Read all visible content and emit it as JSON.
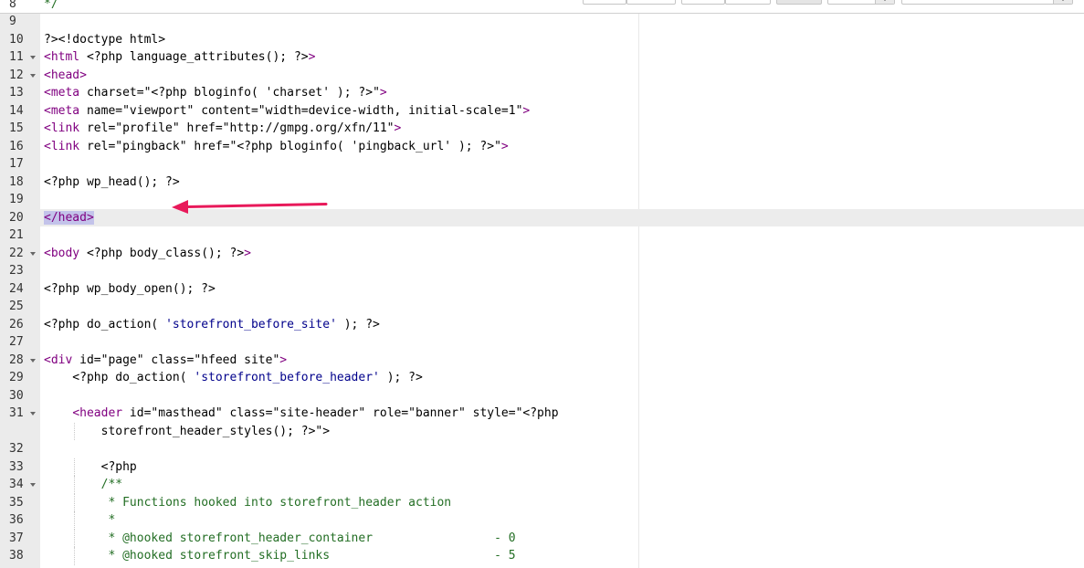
{
  "toolbar": {
    "controls": [
      "",
      "",
      "",
      "",
      "",
      "",
      ""
    ]
  },
  "colors": {
    "tag": "#800080",
    "attr": "#008000",
    "string": "#00008b",
    "comment": "#236e24",
    "arrow": "#e8195a"
  },
  "annotation": {
    "icon": "arrow-left-icon"
  },
  "editor": {
    "lines": [
      {
        "num": "8",
        "fold": false,
        "text": "*/"
      },
      {
        "num": "9",
        "fold": false,
        "text": ""
      },
      {
        "num": "10",
        "fold": false,
        "text": "?><!doctype html>"
      },
      {
        "num": "11",
        "fold": true,
        "text": "<html <?php language_attributes(); ?>>"
      },
      {
        "num": "12",
        "fold": true,
        "text": "<head>"
      },
      {
        "num": "13",
        "fold": false,
        "text": "<meta charset=\"<?php bloginfo( 'charset' ); ?>\">"
      },
      {
        "num": "14",
        "fold": false,
        "text": "<meta name=\"viewport\" content=\"width=device-width, initial-scale=1\">"
      },
      {
        "num": "15",
        "fold": false,
        "text": "<link rel=\"profile\" href=\"http://gmpg.org/xfn/11\">"
      },
      {
        "num": "16",
        "fold": false,
        "text": "<link rel=\"pingback\" href=\"<?php bloginfo( 'pingback_url' ); ?>\">"
      },
      {
        "num": "17",
        "fold": false,
        "text": ""
      },
      {
        "num": "18",
        "fold": false,
        "text": "<?php wp_head(); ?>"
      },
      {
        "num": "19",
        "fold": false,
        "text": ""
      },
      {
        "num": "20",
        "fold": false,
        "text": "</head>"
      },
      {
        "num": "21",
        "fold": false,
        "text": ""
      },
      {
        "num": "22",
        "fold": true,
        "text": "<body <?php body_class(); ?>>"
      },
      {
        "num": "23",
        "fold": false,
        "text": ""
      },
      {
        "num": "24",
        "fold": false,
        "text": "<?php wp_body_open(); ?>"
      },
      {
        "num": "25",
        "fold": false,
        "text": ""
      },
      {
        "num": "26",
        "fold": false,
        "text": "<?php do_action( 'storefront_before_site' ); ?>"
      },
      {
        "num": "27",
        "fold": false,
        "text": ""
      },
      {
        "num": "28",
        "fold": true,
        "text": "<div id=\"page\" class=\"hfeed site\">"
      },
      {
        "num": "29",
        "fold": false,
        "text": "    <?php do_action( 'storefront_before_header' ); ?>"
      },
      {
        "num": "30",
        "fold": false,
        "text": ""
      },
      {
        "num": "31",
        "fold": true,
        "text": "    <header id=\"masthead\" class=\"site-header\" role=\"banner\" style=\"<?php"
      },
      {
        "num": "",
        "fold": false,
        "text": "        storefront_header_styles(); ?>\">"
      },
      {
        "num": "32",
        "fold": false,
        "text": ""
      },
      {
        "num": "33",
        "fold": false,
        "text": "        <?php"
      },
      {
        "num": "34",
        "fold": true,
        "text": "        /**"
      },
      {
        "num": "35",
        "fold": false,
        "text": "         * Functions hooked into storefront_header action"
      },
      {
        "num": "36",
        "fold": false,
        "text": "         *"
      },
      {
        "num": "37",
        "fold": false,
        "text": "         * @hooked storefront_header_container                 - 0"
      },
      {
        "num": "38",
        "fold": false,
        "text": "         * @hooked storefront_skip_links                       - 5"
      }
    ]
  }
}
